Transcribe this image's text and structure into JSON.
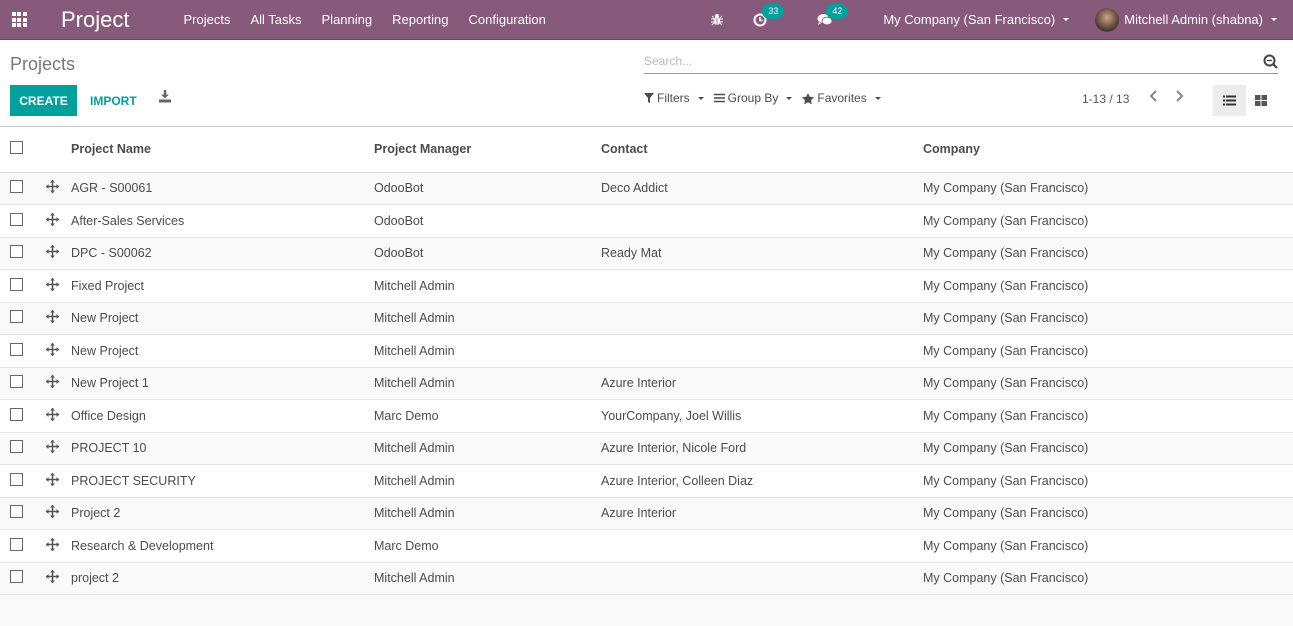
{
  "navbar": {
    "brand": "Project",
    "menu": [
      "Projects",
      "All Tasks",
      "Planning",
      "Reporting",
      "Configuration"
    ],
    "activity_count": "33",
    "messages_count": "42",
    "company": "My Company (San Francisco)",
    "user": "Mitchell Admin (shabna)",
    "accent": "#875a7b",
    "badge_color": "#00a09d"
  },
  "control_panel": {
    "breadcrumb": "Projects",
    "create_label": "CREATE",
    "import_label": "IMPORT",
    "search_placeholder": "Search...",
    "filters_label": "Filters",
    "group_by_label": "Group By",
    "favorites_label": "Favorites",
    "pager": "1-13 / 13",
    "primary_color": "#00a09d"
  },
  "table": {
    "headers": [
      "Project Name",
      "Project Manager",
      "Contact",
      "Company"
    ],
    "rows": [
      {
        "name": "AGR - S00061",
        "manager": "OdooBot",
        "contact": "Deco Addict",
        "company": "My Company (San Francisco)"
      },
      {
        "name": "After-Sales Services",
        "manager": "OdooBot",
        "contact": "",
        "company": "My Company (San Francisco)"
      },
      {
        "name": "DPC - S00062",
        "manager": "OdooBot",
        "contact": "Ready Mat",
        "company": "My Company (San Francisco)"
      },
      {
        "name": "Fixed Project",
        "manager": "Mitchell Admin",
        "contact": "",
        "company": "My Company (San Francisco)"
      },
      {
        "name": "New Project",
        "manager": "Mitchell Admin",
        "contact": "",
        "company": "My Company (San Francisco)"
      },
      {
        "name": "New Project",
        "manager": "Mitchell Admin",
        "contact": "",
        "company": "My Company (San Francisco)"
      },
      {
        "name": "New Project 1",
        "manager": "Mitchell Admin",
        "contact": "Azure Interior",
        "company": "My Company (San Francisco)"
      },
      {
        "name": "Office Design",
        "manager": "Marc Demo",
        "contact": "YourCompany, Joel Willis",
        "company": "My Company (San Francisco)"
      },
      {
        "name": "PROJECT 10",
        "manager": "Mitchell Admin",
        "contact": "Azure Interior, Nicole Ford",
        "company": "My Company (San Francisco)"
      },
      {
        "name": "PROJECT SECURITY",
        "manager": "Mitchell Admin",
        "contact": "Azure Interior, Colleen Diaz",
        "company": "My Company (San Francisco)"
      },
      {
        "name": "Project 2",
        "manager": "Mitchell Admin",
        "contact": "Azure Interior",
        "company": "My Company (San Francisco)"
      },
      {
        "name": "Research & Development",
        "manager": "Marc Demo",
        "contact": "",
        "company": "My Company (San Francisco)"
      },
      {
        "name": "project 2",
        "manager": "Mitchell Admin",
        "contact": "",
        "company": "My Company (San Francisco)"
      }
    ]
  }
}
